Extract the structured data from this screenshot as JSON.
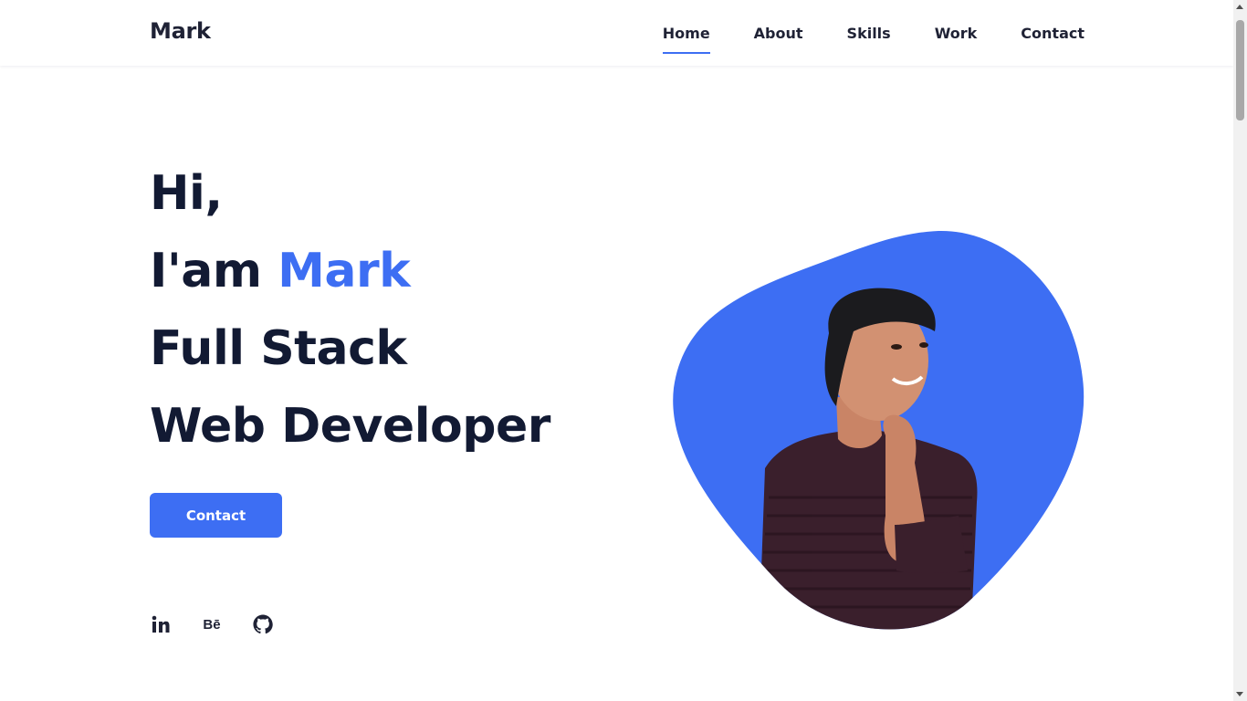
{
  "header": {
    "logo": "Mark",
    "nav": [
      {
        "label": "Home",
        "active": true
      },
      {
        "label": "About",
        "active": false
      },
      {
        "label": "Skills",
        "active": false
      },
      {
        "label": "Work",
        "active": false
      },
      {
        "label": "Contact",
        "active": false
      }
    ]
  },
  "hero": {
    "line1": "Hi,",
    "line2_prefix": "I'am ",
    "line2_name": "Mark",
    "line3": "Full Stack",
    "line4": "Web Developer",
    "cta_label": "Contact"
  },
  "socials": [
    {
      "name": "linkedin-icon",
      "glyph": "in"
    },
    {
      "name": "behance-icon",
      "glyph": "Bē"
    },
    {
      "name": "github-icon",
      "glyph": ""
    }
  ],
  "colors": {
    "accent": "#3d6ef3",
    "text_dark": "#121a33",
    "blob": "#3d6ef3"
  }
}
